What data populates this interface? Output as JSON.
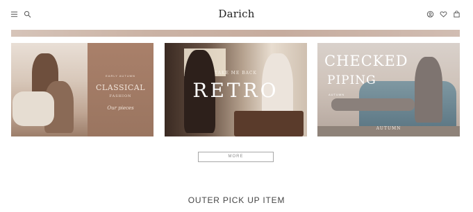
{
  "header": {
    "logo": "Darich",
    "left_icons": [
      "menu-icon",
      "search-icon"
    ],
    "right_icons": [
      "user-icon",
      "heart-icon",
      "bag-icon"
    ]
  },
  "banners": [
    {
      "name": "classical",
      "caption_small": "EARLY AUTUMN",
      "caption_big": "CLASSICAL",
      "caption_sub": "FASHION",
      "caption_script": "Our pieces"
    },
    {
      "name": "retro",
      "caption_small": "TAKE ME BACK",
      "caption_big": "RETRO"
    },
    {
      "name": "checked-piping",
      "caption_big1": "CHECKED",
      "caption_big2": "PIPING",
      "caption_sub": "AUTUMN",
      "caption_foot": "AUTUMN"
    }
  ],
  "more_button": "MORE",
  "section_title": "OUTER PICK UP ITEM",
  "colors": {
    "band": "#cbb3a5",
    "classical_panel": "#a9806a",
    "retro_dark": "#3a2a22",
    "sofa_blue": "#6c8794"
  }
}
